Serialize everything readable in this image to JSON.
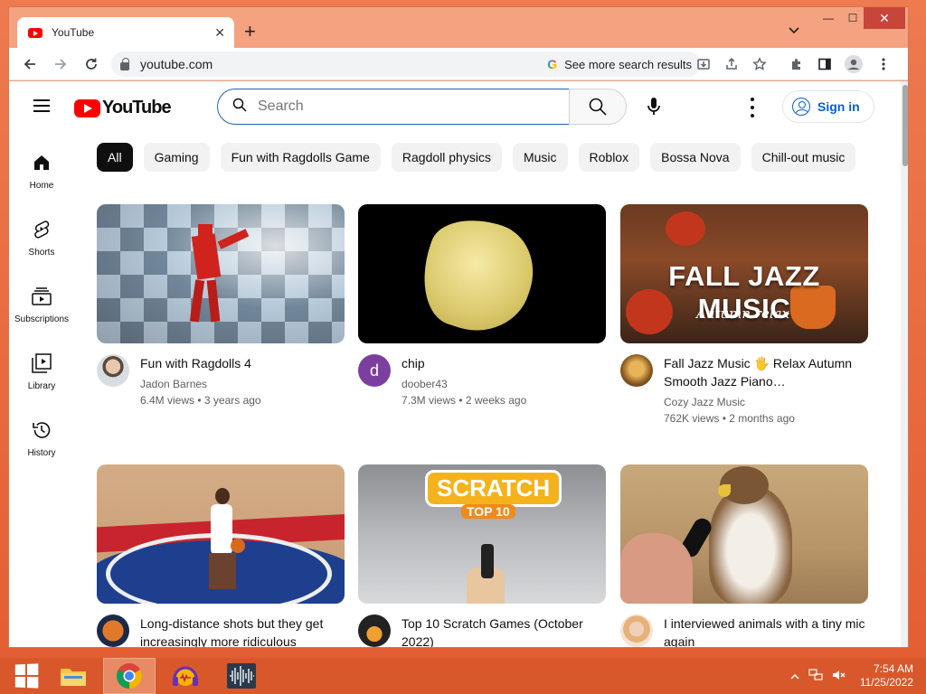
{
  "browser": {
    "tab_title": "YouTube",
    "tab_close": "✕",
    "new_tab": "+",
    "url": "youtube.com",
    "omnibox_chip": "See more search results",
    "window_controls": {
      "minimize": "—",
      "maximize": "☐",
      "close": "✕"
    }
  },
  "youtube": {
    "logo_text": "YouTube",
    "search_placeholder": "Search",
    "sign_in_label": "Sign in",
    "sidebar": [
      {
        "label": "Home",
        "icon": "home-icon"
      },
      {
        "label": "Shorts",
        "icon": "shorts-icon"
      },
      {
        "label": "Subscriptions",
        "icon": "subscriptions-icon"
      },
      {
        "label": "Library",
        "icon": "library-icon"
      },
      {
        "label": "History",
        "icon": "history-icon"
      }
    ],
    "chips": [
      "All",
      "Gaming",
      "Fun with Ragdolls Game",
      "Ragdoll physics",
      "Music",
      "Roblox",
      "Bossa Nova",
      "Chill-out music"
    ],
    "videos": [
      {
        "title": "Fun with Ragdolls 4",
        "channel": "Jadon Barnes",
        "stats": "6.4M views • 3 years ago",
        "avatar_letter": ""
      },
      {
        "title": "chip",
        "channel": "doober43",
        "stats": "7.3M views • 2 weeks ago",
        "avatar_letter": "d"
      },
      {
        "title": "Fall Jazz Music 🖐 Relax Autumn Smooth Jazz Piano…",
        "channel": "Cozy Jazz Music",
        "stats": "762K views • 2 months ago",
        "avatar_letter": "",
        "thumb_text_main": "FALL JAZZ MUSIC",
        "thumb_text_sub": "Autumn relax"
      },
      {
        "title": "Long-distance shots but they get increasingly more ridiculous",
        "channel": "",
        "stats": "",
        "avatar_letter": ""
      },
      {
        "title": "Top 10 Scratch Games (October 2022)",
        "channel": "",
        "stats": "",
        "avatar_letter": "",
        "thumb_text_main": "SCRATCH",
        "thumb_text_sub": "TOP 10"
      },
      {
        "title": "I interviewed animals with a tiny mic again",
        "channel": "",
        "stats": "",
        "avatar_letter": ""
      }
    ]
  },
  "taskbar": {
    "time": "7:54 AM",
    "date": "11/25/2022"
  },
  "colors": {
    "desktop": "#e35f33",
    "youtube_red": "#ff0000",
    "link_blue": "#065fd4"
  }
}
